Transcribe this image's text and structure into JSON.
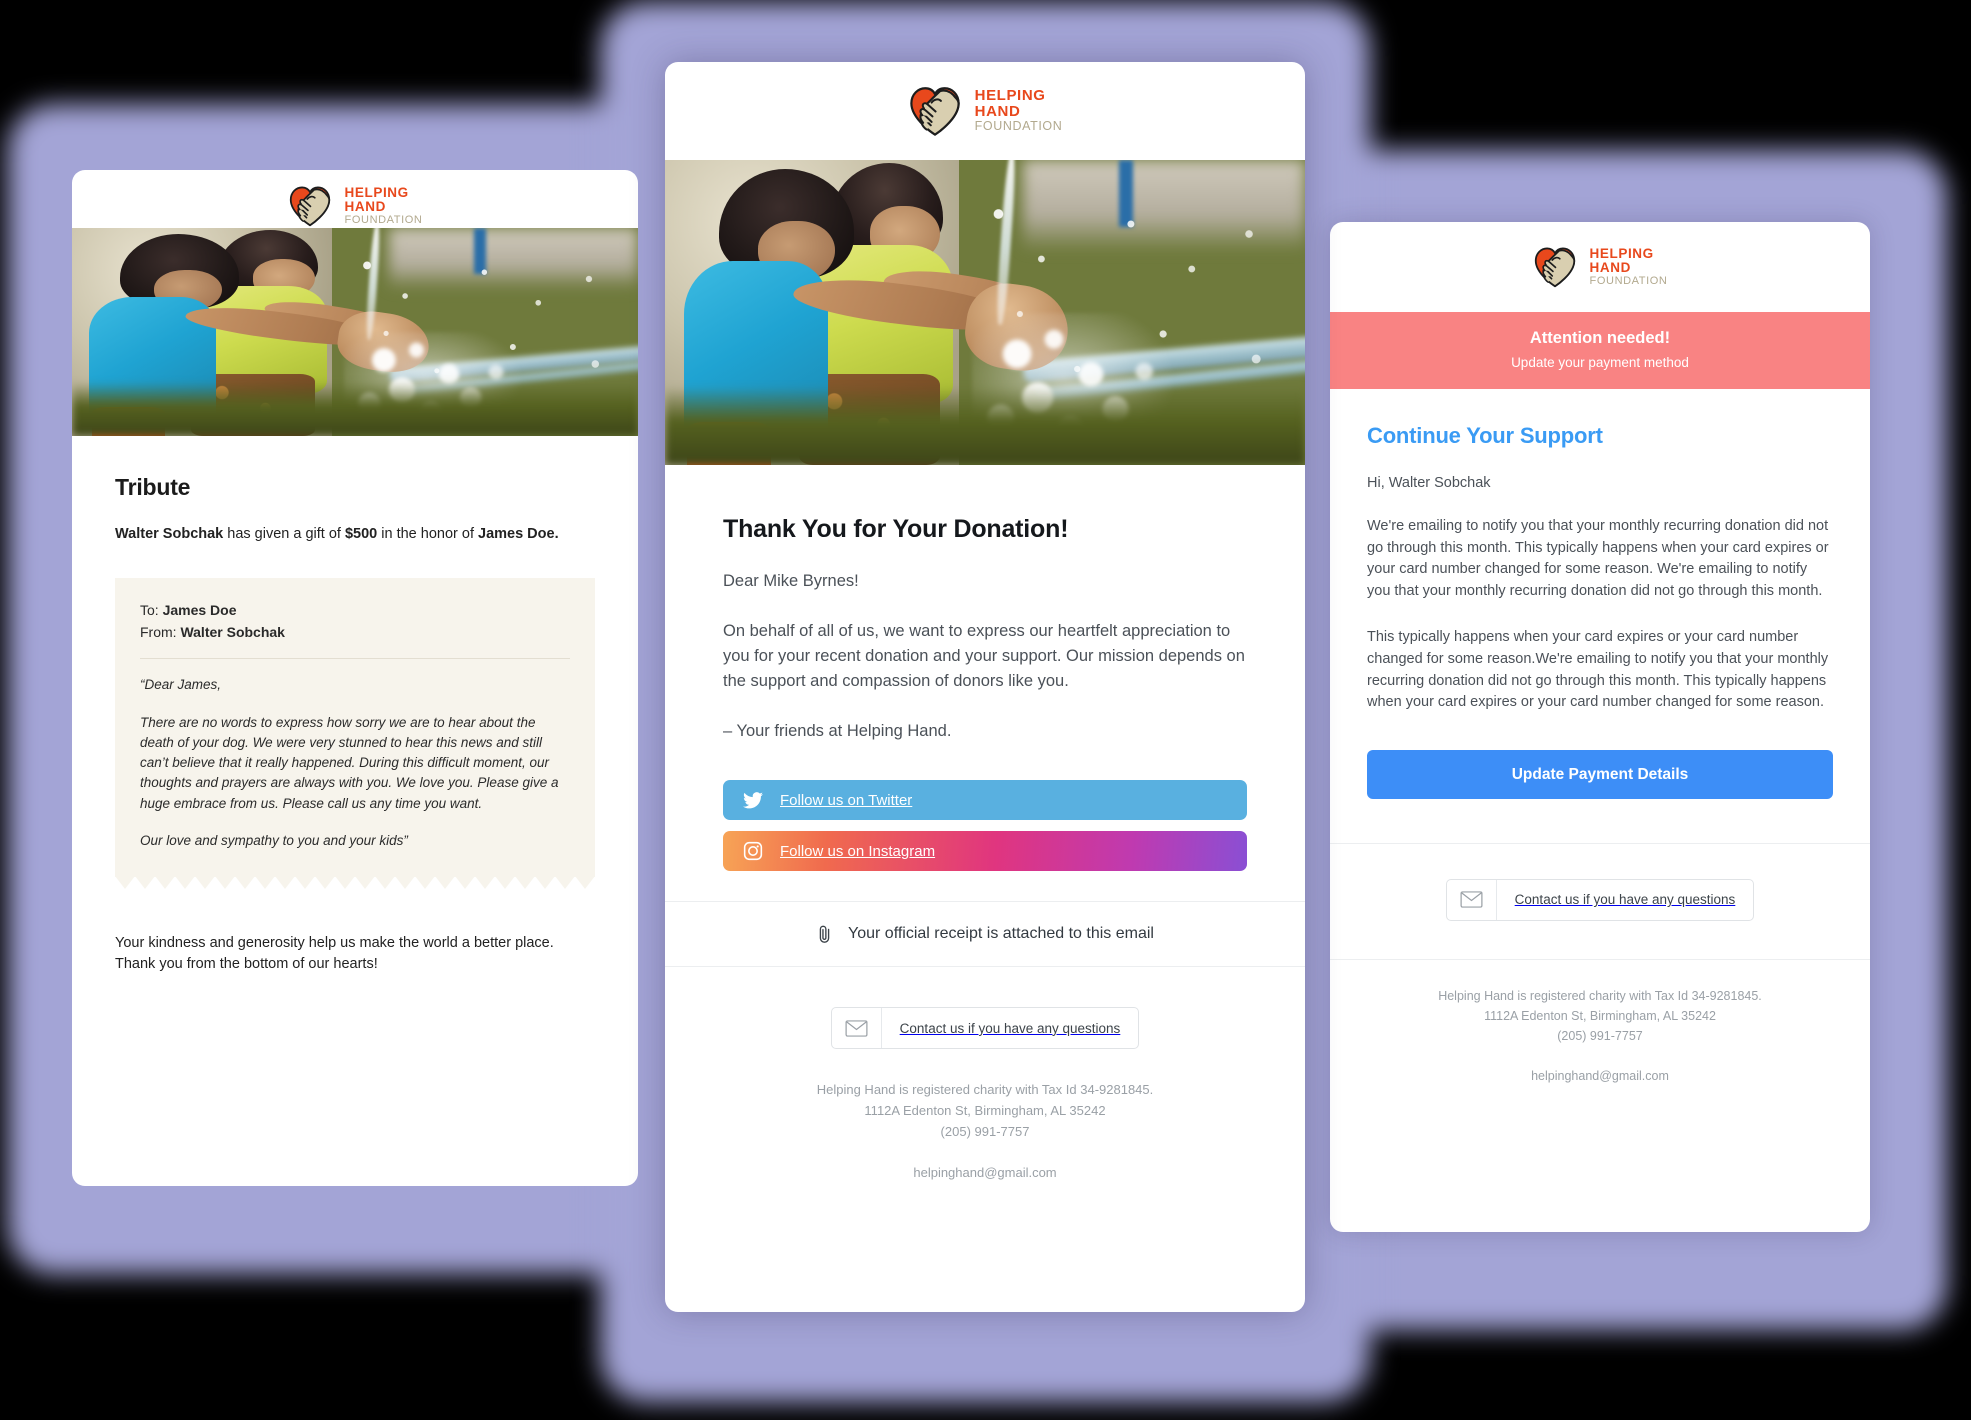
{
  "brand": {
    "line1": "HELPING",
    "line2": "HAND",
    "line3": "FOUNDATION",
    "accent_red": "#e8481c",
    "accent_tan": "#d9cfb0"
  },
  "card_tribute": {
    "title": "Tribute",
    "gift_donor": "Walter Sobchak",
    "gift_mid1": " has given a gift of ",
    "gift_amount": "$500",
    "gift_mid2": " in the honor of ",
    "gift_recipient": "James Doe.",
    "to_label": "To: ",
    "to_value": "James Doe",
    "from_label": "From: ",
    "from_value": "Walter Sobchak",
    "letter_p1": "“Dear James,",
    "letter_p2": "There are no words to express how sorry we are to hear about the death of your dog. We were very stunned to hear this news and still can’t believe that it really happened. During this difficult moment, our thoughts and prayers are always with you. We love you. Please give a huge embrace from us. Please call us any time you want.",
    "letter_p3": "Our love and sympathy to you and your kids”",
    "closing": "Your kindness and generosity help us make the world a better place. Thank you from the bottom of our hearts!"
  },
  "card_thanks": {
    "title": "Thank You for Your Donation!",
    "greeting": "Dear Mike Byrnes!",
    "paragraph": "On behalf of all of us, we want to express our heartfelt appreciation to you for your recent donation and your support. Our mission depends on the support and compassion of donors like you.",
    "signoff": "– Your friends at Helping Hand.",
    "twitter_label": "Follow us on Twitter",
    "instagram_label": "Follow us on Instagram",
    "twitter_color": "#59b0e0",
    "attachment_text": "Your official receipt is attached to this email",
    "contact_label": "Contact us if you have any questions",
    "footer_line1": "Helping Hand is registered charity with Tax Id 34-9281845.",
    "footer_line2": "1112A Edenton St, Birmingham, AL 35242",
    "footer_line3": "(205) 991-7757",
    "footer_email": "helpinghand@gmail.com"
  },
  "card_payment": {
    "alert_title": "Attention needed!",
    "alert_subtitle": "Update your payment method",
    "alert_color": "#f98383",
    "title": "Continue Your Support",
    "title_color": "#3a9bf4",
    "greeting": "Hi, Walter Sobchak",
    "paragraph1": "We're emailing to notify you that your monthly recurring donation did not go through this month. This typically happens when your card expires or your card number changed for some reason. We're emailing to notify you that your monthly recurring donation did not go through this month.",
    "paragraph2": "This typically happens when your card expires or your card number changed for some reason.We're emailing to notify you that your monthly recurring donation did not go through this month. This typically happens when your card expires or your card number changed for some reason.",
    "button_label": "Update Payment Details",
    "button_color": "#3d8ef7",
    "contact_label": "Contact us if you have any questions",
    "footer_line1": "Helping Hand is registered charity with Tax Id 34-9281845.",
    "footer_line2": "1112A Edenton St, Birmingham, AL 35242",
    "footer_line3": "(205) 991-7757",
    "footer_email": "helpinghand@gmail.com"
  },
  "hero_photo": {
    "alt": "Two children playing with splashing water outdoors"
  }
}
